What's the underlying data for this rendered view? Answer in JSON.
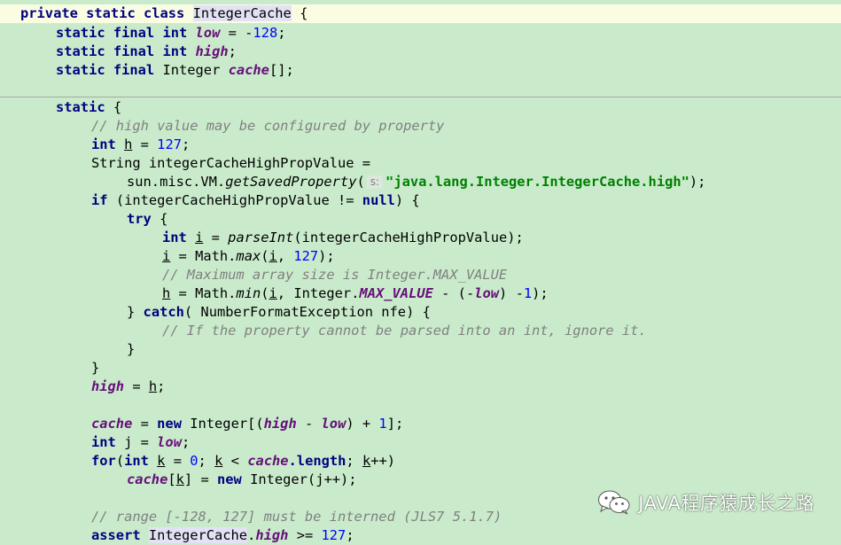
{
  "editor": {
    "lines": [
      {
        "indent": 0,
        "tokens": [
          {
            "t": "private static class ",
            "c": "kw"
          },
          {
            "t": "IntegerCache",
            "c": "hl"
          },
          {
            "t": " {"
          }
        ]
      },
      {
        "indent": 1,
        "tokens": [
          {
            "t": "static final int ",
            "c": "kw"
          },
          {
            "t": "low",
            "c": "fld"
          },
          {
            "t": " = -"
          },
          {
            "t": "128",
            "c": "num"
          },
          {
            "t": ";"
          }
        ]
      },
      {
        "indent": 1,
        "tokens": [
          {
            "t": "static final int ",
            "c": "kw"
          },
          {
            "t": "high",
            "c": "fld"
          },
          {
            "t": ";"
          }
        ]
      },
      {
        "indent": 1,
        "tokens": [
          {
            "t": "static final ",
            "c": "kw"
          },
          {
            "t": "Integer "
          },
          {
            "t": "cache",
            "c": "fld"
          },
          {
            "t": "[];"
          }
        ]
      },
      {
        "indent": 0,
        "tokens": []
      },
      {
        "indent": 1,
        "tokens": [
          {
            "t": "static ",
            "c": "kw"
          },
          {
            "t": "{"
          }
        ]
      },
      {
        "indent": 2,
        "tokens": [
          {
            "t": "// high value may be configured by property",
            "c": "cm"
          }
        ]
      },
      {
        "indent": 2,
        "tokens": [
          {
            "t": "int ",
            "c": "kw"
          },
          {
            "t": "h",
            "c": "lv"
          },
          {
            "t": " = "
          },
          {
            "t": "127",
            "c": "num"
          },
          {
            "t": ";"
          }
        ]
      },
      {
        "indent": 2,
        "tokens": [
          {
            "t": "String integerCacheHighPropValue ="
          }
        ]
      },
      {
        "indent": 3,
        "tokens": [
          {
            "t": "sun.misc.VM."
          },
          {
            "t": "getSavedProperty",
            "c": "mth"
          },
          {
            "t": "("
          },
          {
            "t": "s:",
            "c": "hint"
          },
          {
            "t": "\"java.lang.Integer.IntegerCache.high\"",
            "c": "str"
          },
          {
            "t": ");"
          }
        ]
      },
      {
        "indent": 2,
        "tokens": [
          {
            "t": "if ",
            "c": "kw"
          },
          {
            "t": "(integerCacheHighPropValue != "
          },
          {
            "t": "null",
            "c": "kw"
          },
          {
            "t": ") {"
          }
        ]
      },
      {
        "indent": 3,
        "tokens": [
          {
            "t": "try ",
            "c": "kw"
          },
          {
            "t": "{"
          }
        ]
      },
      {
        "indent": 4,
        "tokens": [
          {
            "t": "int ",
            "c": "kw"
          },
          {
            "t": "i",
            "c": "lv"
          },
          {
            "t": " = "
          },
          {
            "t": "parseInt",
            "c": "mth"
          },
          {
            "t": "(integerCacheHighPropValue);"
          }
        ]
      },
      {
        "indent": 4,
        "tokens": [
          {
            "t": "i",
            "c": "lv"
          },
          {
            "t": " = Math."
          },
          {
            "t": "max",
            "c": "mth"
          },
          {
            "t": "("
          },
          {
            "t": "i",
            "c": "lv"
          },
          {
            "t": ", "
          },
          {
            "t": "127",
            "c": "num"
          },
          {
            "t": ");"
          }
        ]
      },
      {
        "indent": 4,
        "tokens": [
          {
            "t": "// Maximum array size is Integer.MAX_VALUE",
            "c": "cm"
          }
        ]
      },
      {
        "indent": 4,
        "tokens": [
          {
            "t": "h",
            "c": "lv"
          },
          {
            "t": " = Math."
          },
          {
            "t": "min",
            "c": "mth"
          },
          {
            "t": "("
          },
          {
            "t": "i",
            "c": "lv"
          },
          {
            "t": ", Integer."
          },
          {
            "t": "MAX_VALUE",
            "c": "fld"
          },
          {
            "t": " - (-"
          },
          {
            "t": "low",
            "c": "fld"
          },
          {
            "t": ") -"
          },
          {
            "t": "1",
            "c": "num"
          },
          {
            "t": ");"
          }
        ]
      },
      {
        "indent": 3,
        "tokens": [
          {
            "t": "} "
          },
          {
            "t": "catch",
            "c": "kw"
          },
          {
            "t": "( NumberFormatException nfe) {"
          }
        ]
      },
      {
        "indent": 4,
        "tokens": [
          {
            "t": "// If the property cannot be parsed into an int, ignore it.",
            "c": "cm"
          }
        ]
      },
      {
        "indent": 3,
        "tokens": [
          {
            "t": "}"
          }
        ]
      },
      {
        "indent": 2,
        "tokens": [
          {
            "t": "}"
          }
        ]
      },
      {
        "indent": 2,
        "tokens": [
          {
            "t": "high",
            "c": "fld"
          },
          {
            "t": " = "
          },
          {
            "t": "h",
            "c": "lv"
          },
          {
            "t": ";"
          }
        ]
      },
      {
        "indent": 0,
        "tokens": []
      },
      {
        "indent": 2,
        "tokens": [
          {
            "t": "cache",
            "c": "fld"
          },
          {
            "t": " = "
          },
          {
            "t": "new ",
            "c": "kw"
          },
          {
            "t": "Integer[("
          },
          {
            "t": "high",
            "c": "fld"
          },
          {
            "t": " - "
          },
          {
            "t": "low",
            "c": "fld"
          },
          {
            "t": ") + "
          },
          {
            "t": "1",
            "c": "num"
          },
          {
            "t": "];"
          }
        ]
      },
      {
        "indent": 2,
        "tokens": [
          {
            "t": "int ",
            "c": "kw"
          },
          {
            "t": "j = "
          },
          {
            "t": "low",
            "c": "fld"
          },
          {
            "t": ";"
          }
        ]
      },
      {
        "indent": 2,
        "tokens": [
          {
            "t": "for",
            "c": "kw"
          },
          {
            "t": "("
          },
          {
            "t": "int ",
            "c": "kw"
          },
          {
            "t": "k",
            "c": "lv"
          },
          {
            "t": " = "
          },
          {
            "t": "0",
            "c": "num"
          },
          {
            "t": "; "
          },
          {
            "t": "k",
            "c": "lv"
          },
          {
            "t": " < "
          },
          {
            "t": "cache",
            "c": "fld"
          },
          {
            "t": ".length",
            "c": "kw"
          },
          {
            "t": "; "
          },
          {
            "t": "k",
            "c": "lv"
          },
          {
            "t": "++)"
          }
        ]
      },
      {
        "indent": 3,
        "tokens": [
          {
            "t": "cache",
            "c": "fld"
          },
          {
            "t": "["
          },
          {
            "t": "k",
            "c": "lv"
          },
          {
            "t": "] = "
          },
          {
            "t": "new ",
            "c": "kw"
          },
          {
            "t": "Integer(j++);"
          }
        ]
      },
      {
        "indent": 0,
        "tokens": []
      },
      {
        "indent": 2,
        "tokens": [
          {
            "t": "// range [-128, 127] must be interned (JLS7 5.1.7)",
            "c": "cm"
          }
        ]
      },
      {
        "indent": 2,
        "tokens": [
          {
            "t": "assert ",
            "c": "kw"
          },
          {
            "t": "IntegerCache",
            "c": "hl"
          },
          {
            "t": "."
          },
          {
            "t": "high",
            "c": "fld"
          },
          {
            "t": " >= "
          },
          {
            "t": "127",
            "c": "num"
          },
          {
            "t": ";"
          }
        ]
      }
    ]
  },
  "watermark": {
    "icon": "wechat-icon",
    "text": "JAVA程序猿成长之路"
  },
  "colors": {
    "background": "#c9ebcb",
    "current_line": "#fbfde2",
    "keyword": "#000080",
    "field": "#660e7a",
    "number": "#0000ff",
    "string": "#008000",
    "comment": "#808080"
  }
}
